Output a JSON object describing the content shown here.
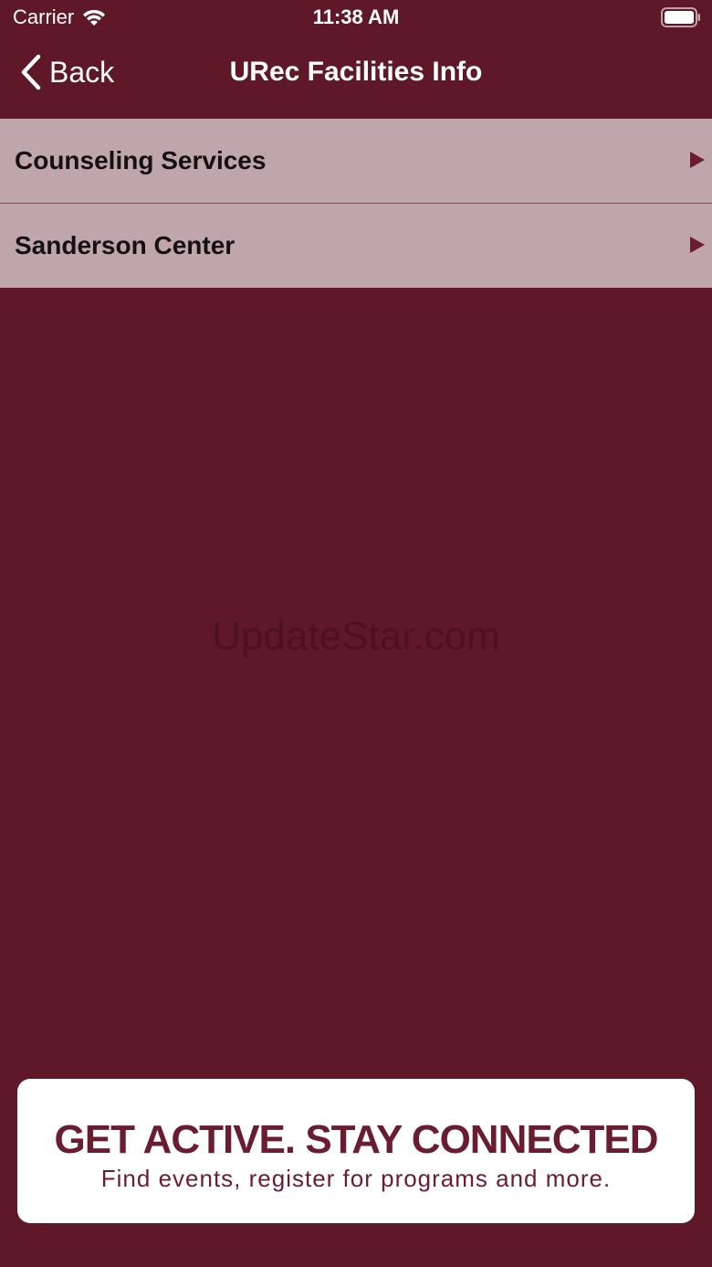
{
  "status_bar": {
    "carrier": "Carrier",
    "time": "11:38 AM"
  },
  "nav": {
    "back_label": "Back",
    "title": "URec Facilities Info"
  },
  "list": {
    "items": [
      {
        "label": "Counseling Services"
      },
      {
        "label": "Sanderson Center"
      }
    ]
  },
  "watermark": "UpdateStar.com",
  "banner": {
    "headline": "GET ACTIVE.  STAY CONNECTED",
    "subline": "Find events, register for programs and more."
  },
  "colors": {
    "background": "#5e1828",
    "list_item": "#bea6ac",
    "accent": "#6a1d30",
    "text_light": "#ffffff"
  },
  "icons": [
    "wifi-icon",
    "battery-icon",
    "chevron-left-icon",
    "disclosure-arrow-icon"
  ]
}
